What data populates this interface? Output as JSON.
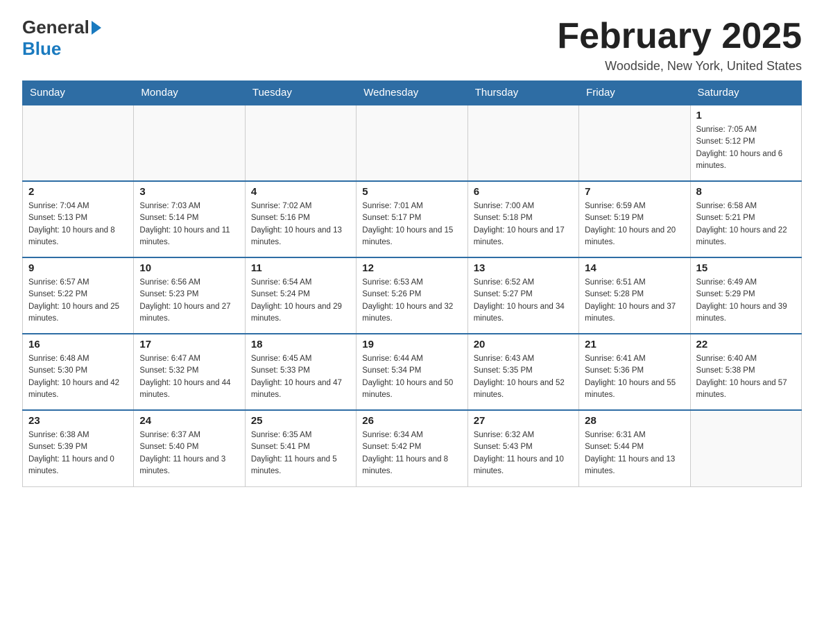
{
  "header": {
    "logo_general": "General",
    "logo_blue": "Blue",
    "month_title": "February 2025",
    "location": "Woodside, New York, United States"
  },
  "weekdays": [
    "Sunday",
    "Monday",
    "Tuesday",
    "Wednesday",
    "Thursday",
    "Friday",
    "Saturday"
  ],
  "weeks": [
    [
      {
        "day": "",
        "info": ""
      },
      {
        "day": "",
        "info": ""
      },
      {
        "day": "",
        "info": ""
      },
      {
        "day": "",
        "info": ""
      },
      {
        "day": "",
        "info": ""
      },
      {
        "day": "",
        "info": ""
      },
      {
        "day": "1",
        "info": "Sunrise: 7:05 AM\nSunset: 5:12 PM\nDaylight: 10 hours and 6 minutes."
      }
    ],
    [
      {
        "day": "2",
        "info": "Sunrise: 7:04 AM\nSunset: 5:13 PM\nDaylight: 10 hours and 8 minutes."
      },
      {
        "day": "3",
        "info": "Sunrise: 7:03 AM\nSunset: 5:14 PM\nDaylight: 10 hours and 11 minutes."
      },
      {
        "day": "4",
        "info": "Sunrise: 7:02 AM\nSunset: 5:16 PM\nDaylight: 10 hours and 13 minutes."
      },
      {
        "day": "5",
        "info": "Sunrise: 7:01 AM\nSunset: 5:17 PM\nDaylight: 10 hours and 15 minutes."
      },
      {
        "day": "6",
        "info": "Sunrise: 7:00 AM\nSunset: 5:18 PM\nDaylight: 10 hours and 17 minutes."
      },
      {
        "day": "7",
        "info": "Sunrise: 6:59 AM\nSunset: 5:19 PM\nDaylight: 10 hours and 20 minutes."
      },
      {
        "day": "8",
        "info": "Sunrise: 6:58 AM\nSunset: 5:21 PM\nDaylight: 10 hours and 22 minutes."
      }
    ],
    [
      {
        "day": "9",
        "info": "Sunrise: 6:57 AM\nSunset: 5:22 PM\nDaylight: 10 hours and 25 minutes."
      },
      {
        "day": "10",
        "info": "Sunrise: 6:56 AM\nSunset: 5:23 PM\nDaylight: 10 hours and 27 minutes."
      },
      {
        "day": "11",
        "info": "Sunrise: 6:54 AM\nSunset: 5:24 PM\nDaylight: 10 hours and 29 minutes."
      },
      {
        "day": "12",
        "info": "Sunrise: 6:53 AM\nSunset: 5:26 PM\nDaylight: 10 hours and 32 minutes."
      },
      {
        "day": "13",
        "info": "Sunrise: 6:52 AM\nSunset: 5:27 PM\nDaylight: 10 hours and 34 minutes."
      },
      {
        "day": "14",
        "info": "Sunrise: 6:51 AM\nSunset: 5:28 PM\nDaylight: 10 hours and 37 minutes."
      },
      {
        "day": "15",
        "info": "Sunrise: 6:49 AM\nSunset: 5:29 PM\nDaylight: 10 hours and 39 minutes."
      }
    ],
    [
      {
        "day": "16",
        "info": "Sunrise: 6:48 AM\nSunset: 5:30 PM\nDaylight: 10 hours and 42 minutes."
      },
      {
        "day": "17",
        "info": "Sunrise: 6:47 AM\nSunset: 5:32 PM\nDaylight: 10 hours and 44 minutes."
      },
      {
        "day": "18",
        "info": "Sunrise: 6:45 AM\nSunset: 5:33 PM\nDaylight: 10 hours and 47 minutes."
      },
      {
        "day": "19",
        "info": "Sunrise: 6:44 AM\nSunset: 5:34 PM\nDaylight: 10 hours and 50 minutes."
      },
      {
        "day": "20",
        "info": "Sunrise: 6:43 AM\nSunset: 5:35 PM\nDaylight: 10 hours and 52 minutes."
      },
      {
        "day": "21",
        "info": "Sunrise: 6:41 AM\nSunset: 5:36 PM\nDaylight: 10 hours and 55 minutes."
      },
      {
        "day": "22",
        "info": "Sunrise: 6:40 AM\nSunset: 5:38 PM\nDaylight: 10 hours and 57 minutes."
      }
    ],
    [
      {
        "day": "23",
        "info": "Sunrise: 6:38 AM\nSunset: 5:39 PM\nDaylight: 11 hours and 0 minutes."
      },
      {
        "day": "24",
        "info": "Sunrise: 6:37 AM\nSunset: 5:40 PM\nDaylight: 11 hours and 3 minutes."
      },
      {
        "day": "25",
        "info": "Sunrise: 6:35 AM\nSunset: 5:41 PM\nDaylight: 11 hours and 5 minutes."
      },
      {
        "day": "26",
        "info": "Sunrise: 6:34 AM\nSunset: 5:42 PM\nDaylight: 11 hours and 8 minutes."
      },
      {
        "day": "27",
        "info": "Sunrise: 6:32 AM\nSunset: 5:43 PM\nDaylight: 11 hours and 10 minutes."
      },
      {
        "day": "28",
        "info": "Sunrise: 6:31 AM\nSunset: 5:44 PM\nDaylight: 11 hours and 13 minutes."
      },
      {
        "day": "",
        "info": ""
      }
    ]
  ]
}
